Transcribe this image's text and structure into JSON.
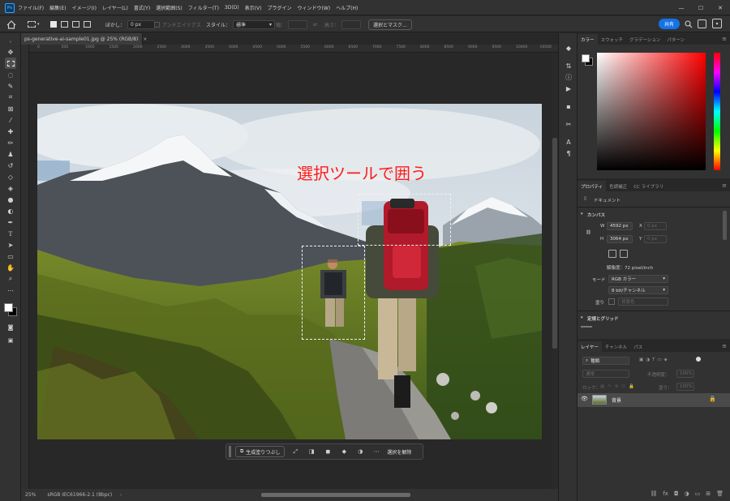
{
  "app": {
    "logo": "Ps"
  },
  "menu": [
    "ファイル(F)",
    "編集(E)",
    "イメージ(I)",
    "レイヤー(L)",
    "書式(Y)",
    "選択範囲(S)",
    "フィルター(T)",
    "3D(D)",
    "表示(V)",
    "プラグイン",
    "ウィンドウ(W)",
    "ヘルプ(H)"
  ],
  "window_controls": {
    "minimize": "—",
    "maximize": "☐",
    "close": "✕"
  },
  "options": {
    "feather_label": "ぼかし：",
    "feather_value": "0 px",
    "antialias_label": "アンチエイリアス",
    "style_label": "スタイル：",
    "style_value": "標準",
    "width_label": "幅：",
    "height_label": "高さ：",
    "select_mask_button": "選択とマスク..."
  },
  "share_button": "共有",
  "document_tab": {
    "title": "ps-generative-ai-sample01.jpg @ 25% (RGB/8)",
    "close": "×"
  },
  "ruler_labels": [
    "0",
    "500",
    "1000",
    "1500",
    "2000",
    "2500",
    "3000",
    "3500",
    "4000",
    "4500",
    "5000",
    "5500",
    "6000",
    "6500",
    "7000",
    "7500",
    "8000",
    "8500",
    "9000",
    "9500",
    "10000",
    "10500"
  ],
  "annotation": "選択ツールで囲う",
  "context_bar": {
    "generative_fill": "生成塗りつぶし",
    "deselect": "選択を解除"
  },
  "status": {
    "zoom": "25%",
    "profile": "sRGB IEC61966-2.1 (8bpc)"
  },
  "color_panel": {
    "tabs": [
      "カラー",
      "スウォッチ",
      "グラデーション",
      "パターン"
    ]
  },
  "properties_panel": {
    "tabs": [
      "プロパティ",
      "色調補正",
      "CC ライブラリ"
    ],
    "doc_label": "ドキュメント",
    "canvas_section": "カンバス",
    "w_label": "W",
    "w_value": "4592 px",
    "h_label": "H",
    "h_value": "3064 px",
    "x_label": "X",
    "x_value": "0 px",
    "y_label": "Y",
    "y_value": "0 px",
    "resolution": "解像度：72 pixel/inch",
    "mode_label": "モード",
    "mode_value": "RGB カラー",
    "depth_value": "8 bit/チャンネル",
    "fill_label": "塗り",
    "fill_value": "背景色",
    "guides_section": "定規とグリッド"
  },
  "layers_panel": {
    "tabs": [
      "レイヤー",
      "チャンネル",
      "パス"
    ],
    "search_placeholder": "種類",
    "blend_mode": "通常",
    "opacity_label": "不透明度：",
    "opacity_value": "100%",
    "lock_label": "ロック：",
    "fill_label": "塗り：",
    "fill_value": "100%",
    "layer_name": "背景"
  },
  "colors": {
    "accent": "#1473e6",
    "annotation": "#ff1a1a",
    "foreground": "#ffffff",
    "background": "#000000"
  }
}
